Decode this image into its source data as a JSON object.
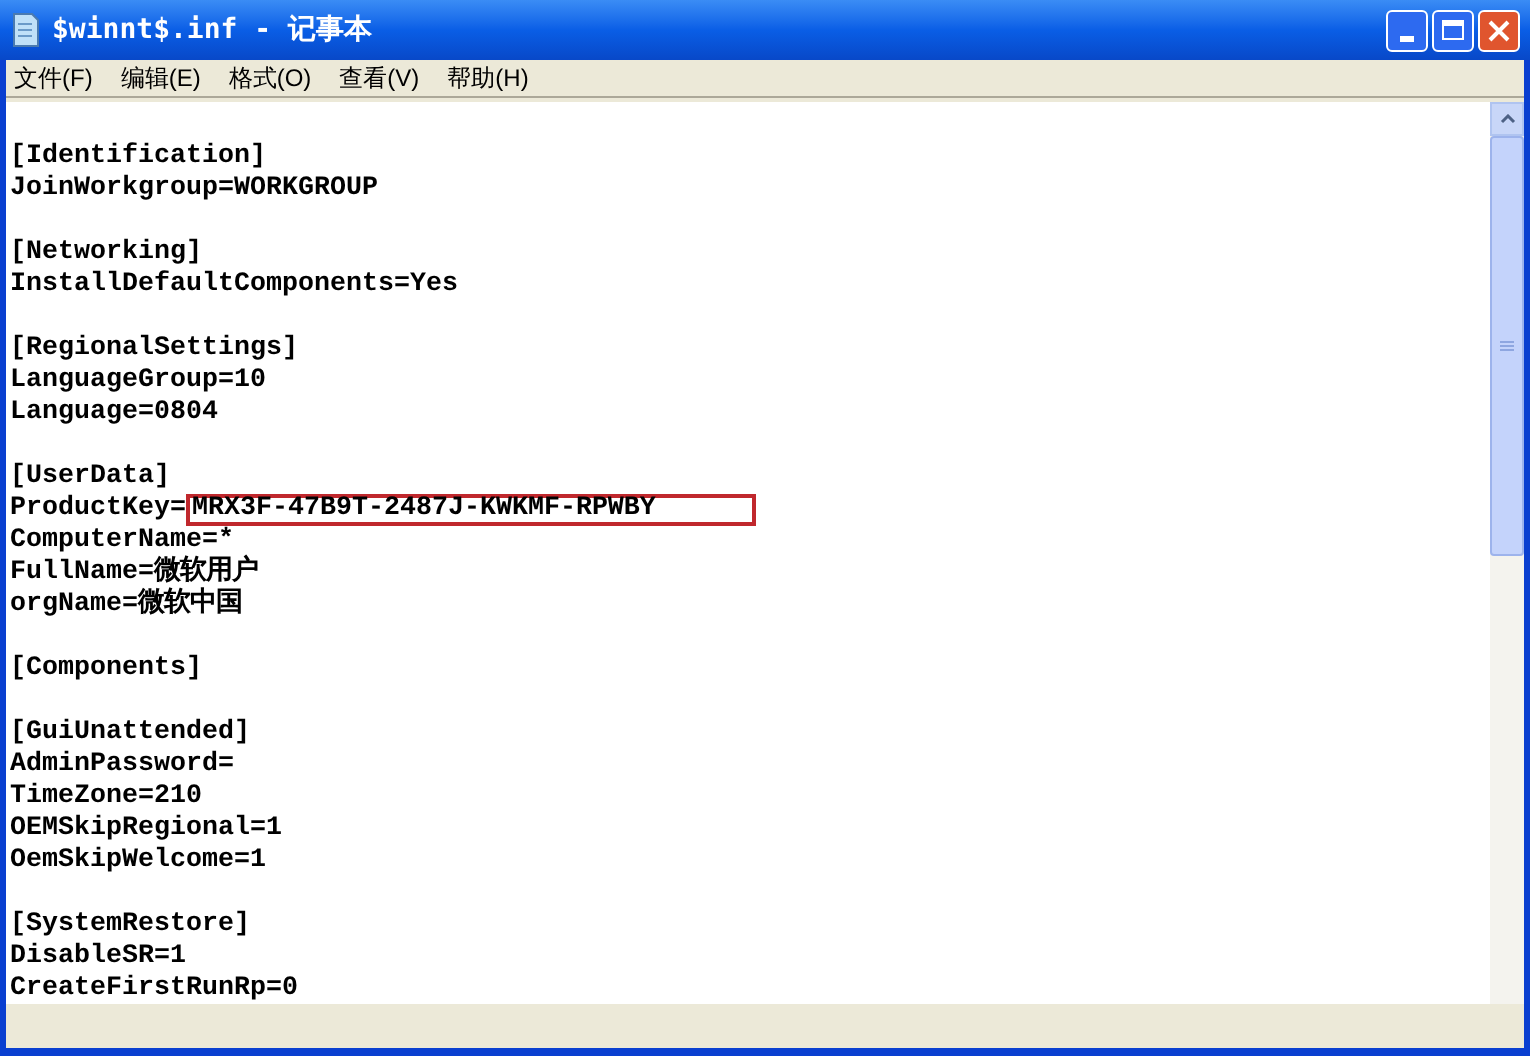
{
  "window": {
    "title": "$winnt$.inf - 记事本"
  },
  "menu": [
    "文件(F)",
    "编辑(E)",
    "格式(O)",
    "查看(V)",
    "帮助(H)"
  ],
  "document": {
    "sections": [
      {
        "header": "[Identification]",
        "entries": [
          {
            "key": "JoinWorkgroup=",
            "value": "WORKGROUP"
          }
        ]
      },
      {
        "header": "[Networking]",
        "entries": [
          {
            "key": "InstallDefaultComponents=",
            "value": "Yes"
          }
        ]
      },
      {
        "header": "[RegionalSettings]",
        "entries": [
          {
            "key": "LanguageGroup=",
            "value": "10"
          },
          {
            "key": "Language=",
            "value": "0804"
          }
        ]
      },
      {
        "header": "[UserData]",
        "entries": [
          {
            "key": "ProductKey=",
            "value": "MRX3F-47B9T-2487J-KWKMF-RPWBY",
            "highlighted": true
          },
          {
            "key": "ComputerName=",
            "value": "*"
          },
          {
            "key": "FullName=",
            "value": "微软用户"
          },
          {
            "key": "orgName=",
            "value": "微软中国"
          }
        ]
      },
      {
        "header": "[Components]"
      },
      {
        "header": "[GuiUnattended]",
        "entries": [
          {
            "key": "AdminPassword="
          },
          {
            "key": "TimeZone=",
            "value": "210"
          },
          {
            "key": "OEMSkipRegional=",
            "value": "1"
          },
          {
            "key": "OemSkipWelcome=",
            "value": "1"
          }
        ]
      },
      {
        "header": "[SystemRestore]",
        "entries": [
          {
            "key": "DisableSR=",
            "value": "1"
          },
          {
            "key": "CreateFirstRunRp=",
            "value": "0"
          }
        ]
      }
    ]
  }
}
